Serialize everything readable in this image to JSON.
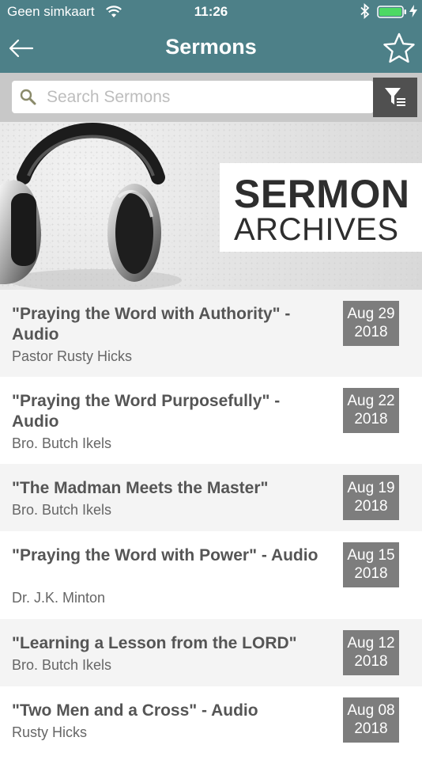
{
  "status": {
    "carrier": "Geen simkaart",
    "time": "11:26"
  },
  "nav": {
    "title": "Sermons"
  },
  "search": {
    "placeholder": "Search Sermons",
    "value": ""
  },
  "banner": {
    "line1": "SERMON",
    "line2": "ARCHIVES"
  },
  "sermons": [
    {
      "title": "\"Praying the Word with Authority\" - Audio",
      "speaker": "Pastor Rusty Hicks",
      "date_month_day": "Aug 29",
      "date_year": "2018"
    },
    {
      "title": "\"Praying the Word Purposefully\" - Audio",
      "speaker": "Bro. Butch Ikels",
      "date_month_day": "Aug 22",
      "date_year": "2018"
    },
    {
      "title": "\"The Madman Meets the Master\"",
      "speaker": "Bro. Butch Ikels",
      "date_month_day": "Aug 19",
      "date_year": "2018"
    },
    {
      "title": "\"Praying the Word with Power\" - Audio",
      "speaker": "Dr. J.K. Minton",
      "date_month_day": "Aug 15",
      "date_year": "2018"
    },
    {
      "title": "\"Learning a Lesson from the LORD\"",
      "speaker": "Bro. Butch Ikels",
      "date_month_day": "Aug 12",
      "date_year": "2018"
    },
    {
      "title": "\"Two Men and a Cross\" - Audio",
      "speaker": "Rusty Hicks",
      "date_month_day": "Aug 08",
      "date_year": "2018"
    }
  ],
  "icons": {
    "back": "back-arrow-icon",
    "favorite": "star-icon",
    "search": "search-icon",
    "filter": "filter-icon",
    "wifi": "wifi-icon",
    "bluetooth": "bluetooth-icon",
    "battery": "battery-icon"
  },
  "colors": {
    "header": "#4d8088",
    "date_badge": "#7d7d7d",
    "filter_button": "#505050",
    "battery": "#4cd964"
  }
}
